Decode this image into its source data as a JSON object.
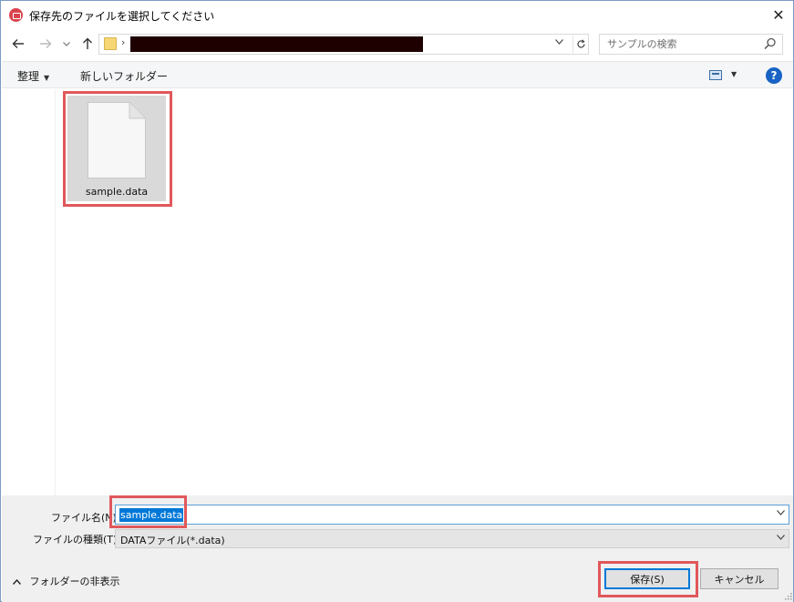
{
  "window": {
    "title": "保存先のファイルを選択してください",
    "close_symbol": "✕"
  },
  "address": {
    "back_icon": "back-arrow-icon",
    "forward_icon": "forward-arrow-icon",
    "up_icon": "up-arrow-icon",
    "separator": "›",
    "path_redacted": true,
    "search_placeholder": "サンプルの検索"
  },
  "toolbar": {
    "organize_label": "整理",
    "new_folder_label": "新しいフォルダー",
    "help_label": "?"
  },
  "files": [
    {
      "name": "sample.data",
      "selected": true,
      "icon": "document-icon"
    }
  ],
  "form": {
    "filename_label": "ファイル名(N):",
    "filename_value": "sample.data",
    "filetype_label": "ファイルの種類(T):",
    "filetype_value": "DATAファイル(*.data)"
  },
  "footer": {
    "hide_folders_label": "フォルダーの非表示",
    "save_label": "保存(S)",
    "cancel_label": "キャンセル"
  },
  "colors": {
    "highlight_box": "#e0585b",
    "selection": "#0078d7",
    "help_icon": "#1863c4",
    "app_icon": "#d9434d"
  }
}
